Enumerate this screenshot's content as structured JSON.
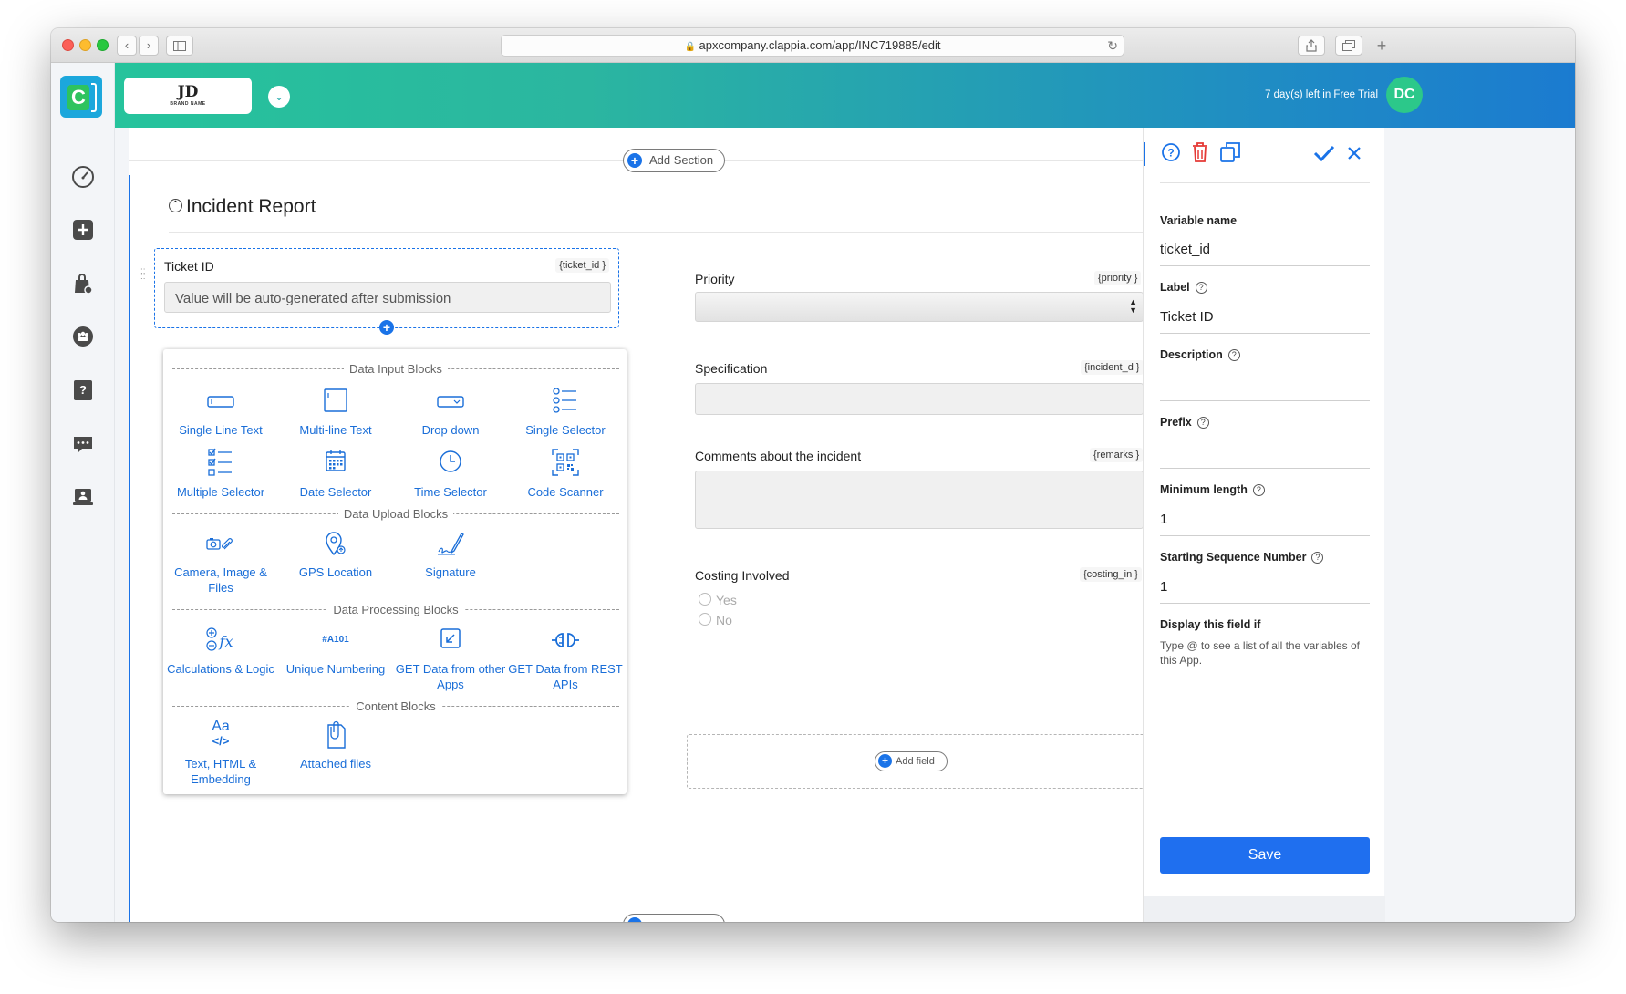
{
  "browser": {
    "url": "apxcompany.clappia.com/app/INC719885/edit"
  },
  "header": {
    "brand_main": "JD",
    "brand_sub": "BRAND NAME",
    "trial_text": "7 day(s) left in Free Trial",
    "avatar_initials": "DC",
    "logo_letter": "C"
  },
  "canvas": {
    "add_section_label": "Add Section",
    "section_title": "Incident Report",
    "add_field_label": "Add field",
    "fields": {
      "ticket": {
        "label": "Ticket ID",
        "var": "{ticket_id }",
        "placeholder": "Value will be auto-generated after submission"
      },
      "priority": {
        "label": "Priority",
        "var": "{priority }"
      },
      "specification": {
        "label": "Specification",
        "var": "{incident_d }"
      },
      "comments": {
        "label": "Comments about the incident",
        "var": "{remarks }"
      },
      "costing": {
        "label": "Costing Involved",
        "var": "{costing_in }",
        "options": [
          "Yes",
          "No"
        ]
      }
    }
  },
  "popup": {
    "categories": {
      "data_input": "Data Input Blocks",
      "data_upload": "Data Upload Blocks",
      "data_processing": "Data Processing Blocks",
      "content": "Content Blocks"
    },
    "blocks": {
      "single_line": "Single Line Text",
      "multi_line": "Multi-line Text",
      "drop_down": "Drop down",
      "single_selector": "Single Selector",
      "multiple_selector": "Multiple Selector",
      "date_selector": "Date Selector",
      "time_selector": "Time Selector",
      "code_scanner": "Code Scanner",
      "camera": "Camera, Image & Files",
      "gps": "GPS Location",
      "signature": "Signature",
      "calculations": "Calculations & Logic",
      "unique_numbering": "Unique Numbering",
      "unique_numbering_icon": "#A101",
      "get_apps": "GET Data from other Apps",
      "get_rest": "GET Data from REST APIs",
      "text_html": "Text, HTML & Embedding",
      "text_html_icon": "Aa",
      "attached_files": "Attached files"
    }
  },
  "properties": {
    "variable_name_label": "Variable name",
    "variable_name_value": "ticket_id",
    "label_label": "Label",
    "label_value": "Ticket ID",
    "description_label": "Description",
    "description_value": "",
    "prefix_label": "Prefix",
    "prefix_value": "",
    "min_length_label": "Minimum length",
    "min_length_value": "1",
    "start_seq_label": "Starting Sequence Number",
    "start_seq_value": "1",
    "display_if_label": "Display this field if",
    "display_if_hint": "Type @ to see a list of all the variables of this App.",
    "save_label": "Save"
  },
  "colors": {
    "accent": "#1a73e8",
    "header_start": "#25c59b",
    "header_end": "#1b7bd0",
    "delete": "#e53935",
    "avatar": "#2cc88a"
  }
}
